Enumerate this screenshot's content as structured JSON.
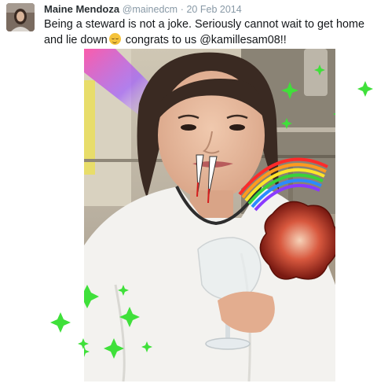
{
  "tweet": {
    "author_name": "Maine Mendoza",
    "handle": "@mainedcm",
    "separator": "·",
    "date": "20 Feb 2014",
    "text_part1": "Being a steward is not a joke. Seriously cannot wait to get home and lie down",
    "emoji": "relieved-face-emoji",
    "text_part2": " congrats to us @kamillesam08!!"
  },
  "colors": {
    "name": "#292f33",
    "meta": "#8899a6",
    "text": "#14171a",
    "sparkle": "#3fe03a"
  },
  "photo": {
    "stickers": [
      "vampire-fangs-sticker",
      "rainbow-sticker",
      "flame-blob-sticker",
      "green-sparkles-sticker",
      "rainbow-light-beam-sticker"
    ]
  }
}
